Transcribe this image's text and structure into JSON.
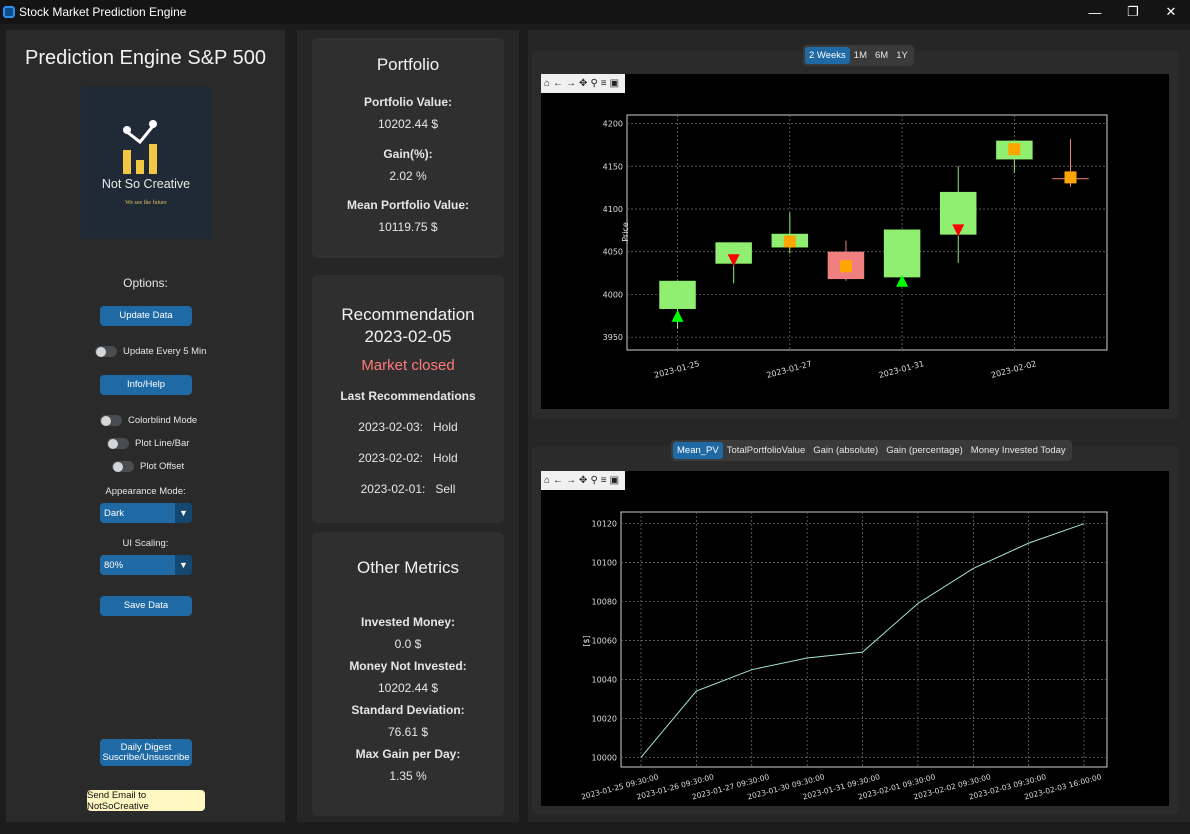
{
  "window": {
    "title": "Stock Market Prediction Engine",
    "minimize": "—",
    "restore": "❐",
    "close": "✕"
  },
  "sidebar": {
    "title": "Prediction Engine S&P 500",
    "logo_text": "Not So Creative",
    "logo_tagline": "We see the future",
    "options_label": "Options:",
    "update_data": "Update Data",
    "update_every": "Update Every 5 Min",
    "info_help": "Info/Help",
    "colorblind": "Colorblind Mode",
    "plot_line_bar": "Plot Line/Bar",
    "plot_offset": "Plot Offset",
    "appearance_label": "Appearance Mode:",
    "appearance_value": "Dark",
    "scaling_label": "UI Scaling:",
    "scaling_value": "80%",
    "save_data": "Save Data",
    "digest_line1": "Daily Digest",
    "digest_line2": "Suscribe/Unsuscribe",
    "send_email": "Send Email to NotSoCreative"
  },
  "portfolio": {
    "title": "Portfolio",
    "value_label": "Portfolio Value:",
    "value": "10202.44 $",
    "gain_label": "Gain(%):",
    "gain": "2.02 %",
    "mean_label": "Mean Portfolio Value:",
    "mean": "10119.75 $"
  },
  "recommendation": {
    "title": "Recommendation",
    "date": "2023-02-05",
    "status": "Market closed",
    "status_color": "#ff7a7a",
    "last_label": "Last Recommendations",
    "items": [
      {
        "date": "2023-02-03:",
        "action": "Hold"
      },
      {
        "date": "2023-02-02:",
        "action": "Hold"
      },
      {
        "date": "2023-02-01:",
        "action": "Sell"
      }
    ]
  },
  "other": {
    "title": "Other Metrics",
    "invested_label": "Invested Money:",
    "invested": "0.0 $",
    "not_invested_label": "Money Not Invested:",
    "not_invested": "10202.44 $",
    "std_label": "Standard Deviation:",
    "std": "76.61 $",
    "maxgain_label": "Max Gain per Day:",
    "maxgain": "1.35 %"
  },
  "top_plot": {
    "ranges": [
      "2 Weeks",
      "1M",
      "6M",
      "1Y"
    ],
    "active_range": "2 Weeks",
    "toolbar_icons": [
      "home-icon",
      "back-icon",
      "forward-icon",
      "pan-icon",
      "zoom-icon",
      "configure-icon",
      "save-icon"
    ]
  },
  "bottom_plot": {
    "tabs": [
      "Mean_PV",
      "TotalPortfolioValue",
      "Gain (absolute)",
      "Gain (percentage)",
      "Money Invested Today"
    ],
    "active_tab": "Mean_PV"
  },
  "chart_data": [
    {
      "type": "candlestick",
      "ylabel": "Price",
      "xlabel": "",
      "ylim": [
        3935,
        4210
      ],
      "yticks": [
        3950,
        4000,
        4050,
        4100,
        4150,
        4200
      ],
      "xtick_labels": [
        "2023-01-25",
        "2023-01-27",
        "2023-01-31",
        "2023-02-02"
      ],
      "candles": [
        {
          "open": 3983,
          "close": 4016,
          "high": 4016,
          "low": 3960,
          "color": "#90ee70",
          "marker": "up",
          "marker_y": 3975
        },
        {
          "open": 4036,
          "close": 4061,
          "high": 4061,
          "low": 4013,
          "color": "#90ee70",
          "marker": "down",
          "marker_y": 4040
        },
        {
          "open": 4055,
          "close": 4071,
          "high": 4096,
          "low": 4048,
          "color": "#90ee70",
          "marker": "square",
          "marker_y": 4062
        },
        {
          "open": 4018,
          "close": 4050,
          "high": 4063,
          "low": 4016,
          "color": "#f08080",
          "marker": "square",
          "marker_y": 4033
        },
        {
          "open": 4020,
          "close": 4076,
          "high": 4076,
          "low": 4012,
          "color": "#90ee70",
          "marker": "up",
          "marker_y": 4016
        },
        {
          "open": 4070,
          "close": 4120,
          "high": 4150,
          "low": 4037,
          "color": "#90ee70",
          "marker": "down",
          "marker_y": 4075
        },
        {
          "open": 4158,
          "close": 4180,
          "high": 4180,
          "low": 4142,
          "color": "#90ee70",
          "marker": "square",
          "marker_y": 4170
        },
        {
          "open": 4136,
          "close": 4136,
          "high": 4182,
          "low": 4126,
          "color": "#f08080",
          "marker": "square",
          "marker_y": 4137
        }
      ]
    },
    {
      "type": "line",
      "ylabel": "[$]",
      "ylim": [
        9995,
        10126
      ],
      "yticks": [
        10000,
        10020,
        10040,
        10060,
        10080,
        10100,
        10120
      ],
      "x": [
        "2023-01-25 09:30:00",
        "2023-01-26 09:30:00",
        "2023-01-27 09:30:00",
        "2023-01-30 09:30:00",
        "2023-01-31 09:30:00",
        "2023-02-01 09:30:00",
        "2023-02-02 09:30:00",
        "2023-02-03 09:30:00",
        "2023-02-03 16:00:00"
      ],
      "series": [
        {
          "values": [
            10000,
            10034,
            10045,
            10051,
            10054,
            10079,
            10097,
            10110,
            10120
          ],
          "color": "#a8e6cf"
        }
      ]
    }
  ]
}
